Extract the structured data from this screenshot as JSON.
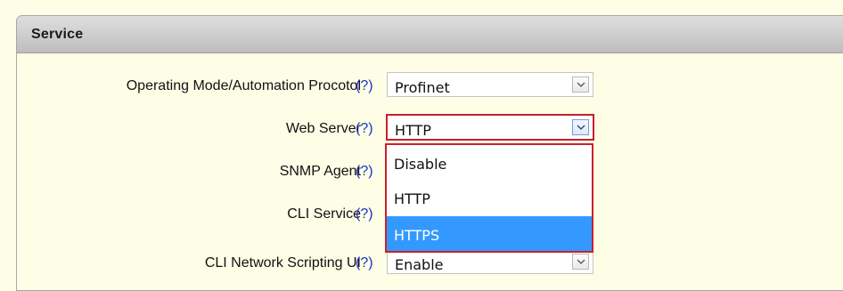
{
  "panel": {
    "title": "Service"
  },
  "help_text": "(?)",
  "fields": [
    {
      "label": "Operating Mode/Automation Procotol",
      "value": "Profinet"
    },
    {
      "label": "Web Server",
      "value": "HTTP"
    },
    {
      "label": "SNMP Agent",
      "value": ""
    },
    {
      "label": "CLI Service",
      "value": ""
    },
    {
      "label": "CLI Network Scripting UI",
      "value": "Enable"
    }
  ],
  "dropdown": {
    "options": [
      "Disable",
      "HTTP",
      "HTTPS"
    ],
    "highlighted": "HTTPS"
  },
  "colors": {
    "background": "#fefde6",
    "header": "#cdcdcd",
    "help_link": "#1a33cc",
    "focus_border": "#c8202c",
    "highlight": "#3399ff"
  },
  "icons": {
    "dropdown_arrow": "chevron-down-icon"
  }
}
